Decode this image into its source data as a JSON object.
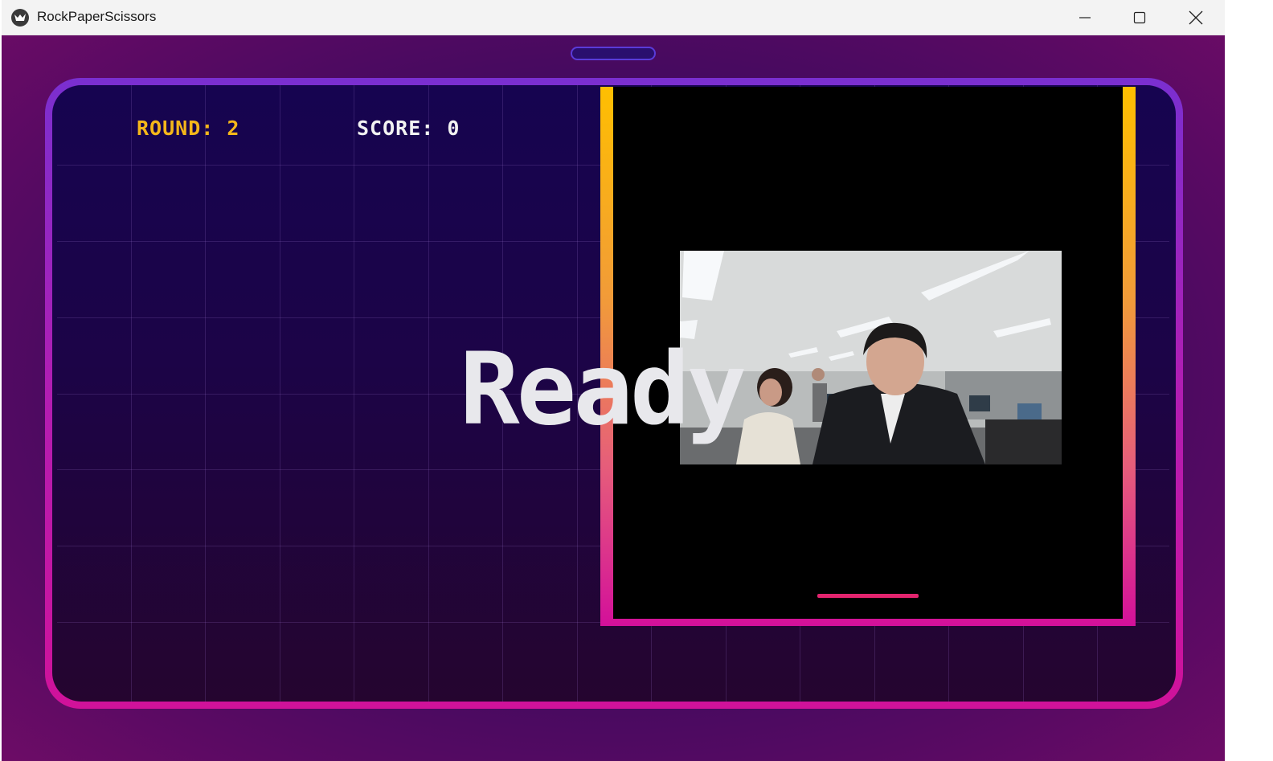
{
  "window": {
    "title": "RockPaperScissors",
    "app_icon": "kivy-bird-icon",
    "controls": {
      "minimize_icon": "minimize-icon",
      "maximize_icon": "maximize-icon",
      "close_icon": "close-icon"
    }
  },
  "hud": {
    "round_text": "ROUND: 2",
    "score_text": "SCORE: 0"
  },
  "overlay": {
    "status_text": "Ready"
  },
  "camera": {
    "feed_description": "webcam-feed"
  },
  "colors": {
    "round_color": "#f5b71a",
    "score_color": "#f2f2f2",
    "frame_gradient_top": "#7a2fd0",
    "frame_gradient_bottom": "#d0129a",
    "panel_border_top": "#ffbf00",
    "panel_border_bottom": "#d3109a",
    "progress_color": "#e2246e"
  }
}
